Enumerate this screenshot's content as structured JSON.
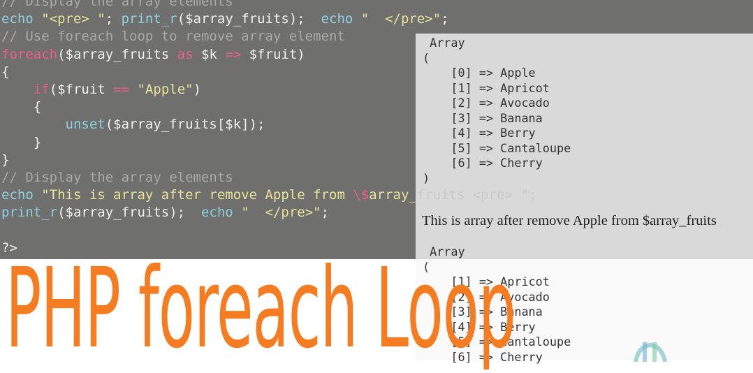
{
  "code": {
    "lines": [
      [
        {
          "t": "// Display the array elements",
          "c": "cm"
        }
      ],
      [
        {
          "t": "echo ",
          "c": "fn"
        },
        {
          "t": "\"<pre> \"",
          "c": "st"
        },
        {
          "t": "; ",
          "c": ""
        },
        {
          "t": "print_r",
          "c": "fn"
        },
        {
          "t": "($array_fruits);  ",
          "c": ""
        },
        {
          "t": "echo ",
          "c": "fn"
        },
        {
          "t": "\"  </pre>\"",
          "c": "st"
        },
        {
          "t": ";",
          "c": ""
        }
      ],
      [
        {
          "t": "// Use foreach loop to remove array element",
          "c": "cm"
        }
      ],
      [
        {
          "t": "foreach",
          "c": "kw"
        },
        {
          "t": "($array_fruits ",
          "c": ""
        },
        {
          "t": "as",
          "c": "kw"
        },
        {
          "t": " $k ",
          "c": ""
        },
        {
          "t": "=>",
          "c": "kw"
        },
        {
          "t": " $fruit)",
          "c": ""
        }
      ],
      [
        {
          "t": "{",
          "c": ""
        }
      ],
      [
        {
          "t": "    ",
          "c": ""
        },
        {
          "t": "if",
          "c": "kw"
        },
        {
          "t": "($fruit ",
          "c": ""
        },
        {
          "t": "==",
          "c": "kw"
        },
        {
          "t": " ",
          "c": ""
        },
        {
          "t": "\"Apple\"",
          "c": "st"
        },
        {
          "t": ")",
          "c": ""
        }
      ],
      [
        {
          "t": "    {",
          "c": ""
        }
      ],
      [
        {
          "t": "        ",
          "c": ""
        },
        {
          "t": "unset",
          "c": "fn"
        },
        {
          "t": "($array_fruits[$k]);",
          "c": ""
        }
      ],
      [
        {
          "t": "    }",
          "c": ""
        }
      ],
      [
        {
          "t": "}",
          "c": ""
        }
      ],
      [
        {
          "t": "// Display the array elements",
          "c": "cm"
        }
      ],
      [
        {
          "t": "echo ",
          "c": "fn"
        },
        {
          "t": "\"This is array after remove Apple from ",
          "c": "st"
        },
        {
          "t": "\\$",
          "c": "kw"
        },
        {
          "t": "array_",
          "c": "st"
        },
        {
          "t": "fruits <pre> \";",
          "c": "ov"
        }
      ],
      [
        {
          "t": "print_r",
          "c": "fn"
        },
        {
          "t": "($array_fruits);  ",
          "c": ""
        },
        {
          "t": "echo ",
          "c": "fn"
        },
        {
          "t": "\"  </pre>\"",
          "c": "st"
        },
        {
          "t": ";",
          "c": ""
        }
      ],
      [
        {
          "t": "",
          "c": ""
        }
      ],
      [
        {
          "t": "?>",
          "c": ""
        }
      ]
    ]
  },
  "output": {
    "before": [
      "Array",
      "(",
      "    [0] => Apple",
      "    [1] => Apricot",
      "    [2] => Avocado",
      "    [3] => Banana",
      "    [4] => Berry",
      "    [5] => Cantaloupe",
      "    [6] => Cherry",
      ")"
    ],
    "message": "This is array after remove Apple from $array_fruits",
    "after": [
      "Array",
      "(",
      "    [1] => Apricot",
      "    [2] => Avocado",
      "    [3] => Banana",
      "    [4] => Berry",
      "    [5] => Cantaloupe",
      "    [6] => Cherry"
    ]
  },
  "title": "PHP foreach Loop",
  "colors": {
    "title": "#f57c20",
    "code_bg": "#6f6f6d",
    "output_bg": "#d9d9d9"
  }
}
